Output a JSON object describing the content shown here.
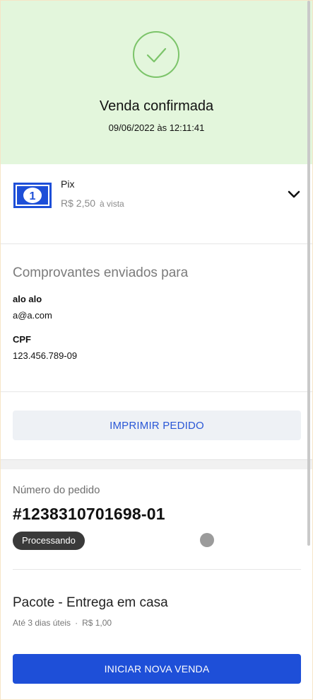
{
  "header": {
    "title": "Venda confirmada",
    "datetime": "09/06/2022 às 12:11:41",
    "status_icon": "check-circle-icon",
    "accent": "#7cc46a",
    "background": "#e3f6dc"
  },
  "payment": {
    "method": "Pix",
    "amount": "R$ 2,50",
    "condition": "à vista",
    "icon": "banknote-icon",
    "expand_icon": "chevron-down-icon"
  },
  "receipts": {
    "title": "Comprovantes enviados para",
    "name": "alo alo",
    "email": "a@a.com",
    "doc_label": "CPF",
    "doc_value": "123.456.789-09"
  },
  "print": {
    "label": "IMPRIMIR PEDIDO"
  },
  "order": {
    "label": "Número do pedido",
    "number": "#1238310701698-01",
    "status": "Processando"
  },
  "shipping": {
    "title": "Pacote - Entrega em casa",
    "eta": "Até 3 dias úteis",
    "separator": "·",
    "price": "R$ 1,00"
  },
  "actions": {
    "new_sale": "INICIAR NOVA VENDA"
  },
  "colors": {
    "primary": "#1e4fd8",
    "link": "#2a57d6",
    "badge": "#3a3a3a"
  }
}
